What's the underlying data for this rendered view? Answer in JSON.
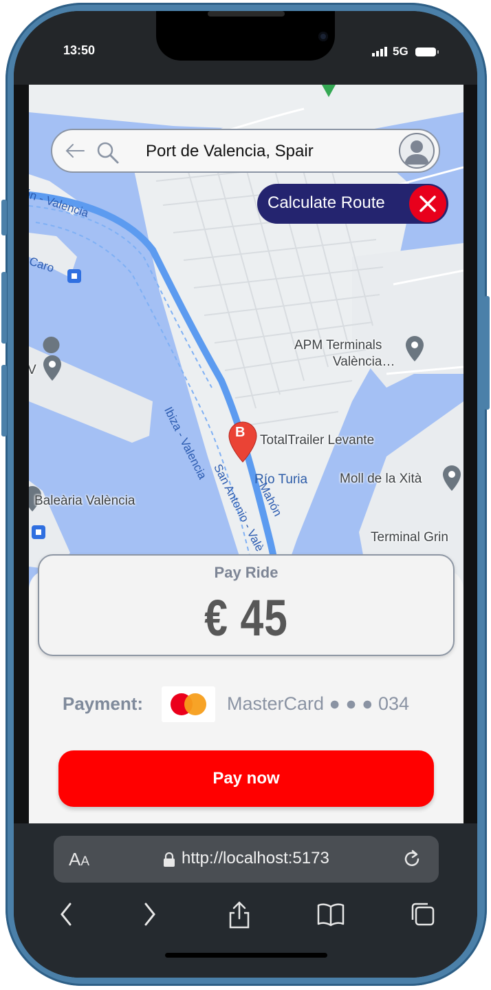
{
  "status_bar": {
    "time": "13:50",
    "network": "5G"
  },
  "map": {
    "labels": {
      "route_top": "ón - Valencia",
      "caro": "Caro",
      "route_main": "Ibiza - Valencia",
      "route_sa": "San Antonio - Valè",
      "route_mahon": "Mahón",
      "apm1": "APM Terminals",
      "apm2": "València…",
      "v_edge": "V",
      "totaltrailer": "TotalTrailer Levante",
      "rio": "Río Turia",
      "moll": "Moll de la Xità",
      "balearia": "Baleària València",
      "terminal": "Terminal Grin"
    },
    "marker_letter": "B"
  },
  "search": {
    "query": "Port de Valencia, Spair"
  },
  "calculate_route": {
    "label": "Calculate Route"
  },
  "pay_card": {
    "title": "Pay Ride",
    "amount": "€ 45"
  },
  "payment": {
    "label": "Payment:",
    "card": "MasterCard ● ● ● 034"
  },
  "pay_button": {
    "label": "Pay now"
  },
  "browser": {
    "aa_big": "A",
    "aa_small": "A",
    "url": "http://localhost:5173"
  },
  "colors": {
    "accent_red": "#ff0000",
    "navy": "#24246f",
    "map_water": "#a4c0f4",
    "route_blue": "#5c9bf0"
  }
}
